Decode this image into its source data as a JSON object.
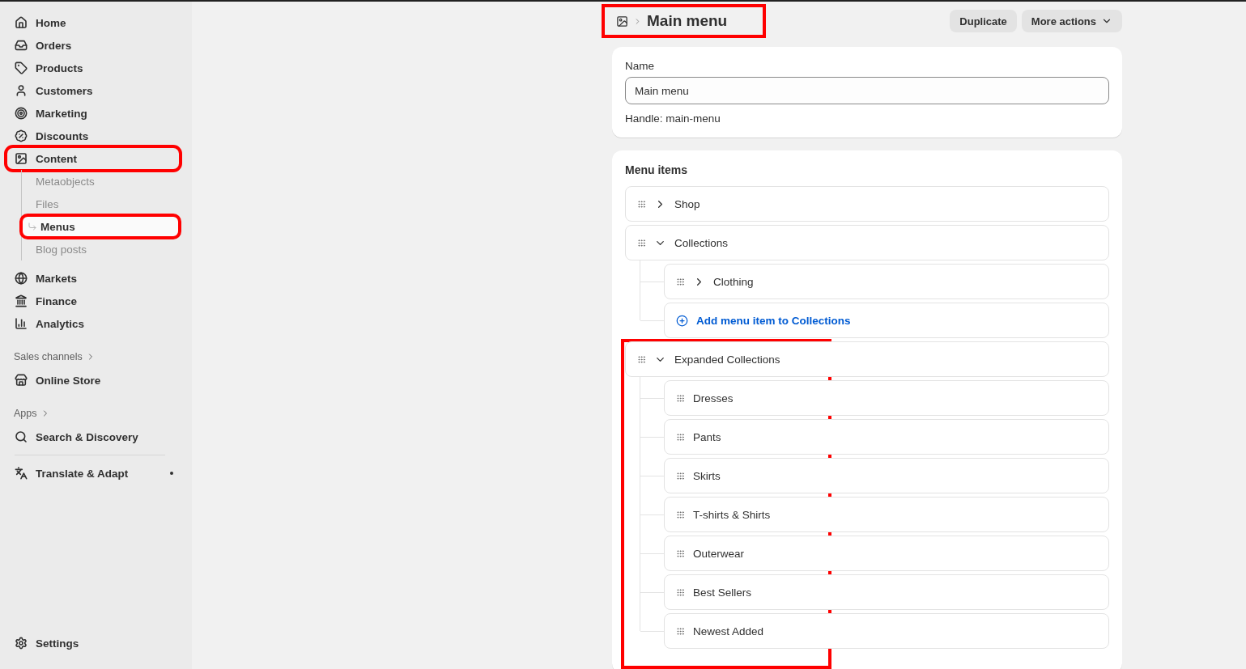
{
  "sidebar": {
    "items": [
      {
        "label": "Home",
        "selected": false,
        "annotated": false
      },
      {
        "label": "Orders",
        "selected": false,
        "annotated": false
      },
      {
        "label": "Products",
        "selected": false,
        "annotated": false
      },
      {
        "label": "Customers",
        "selected": false,
        "annotated": false
      },
      {
        "label": "Marketing",
        "selected": false,
        "annotated": false
      },
      {
        "label": "Discounts",
        "selected": false,
        "annotated": false
      },
      {
        "label": "Content",
        "selected": false,
        "annotated": true,
        "children": [
          {
            "label": "Metaobjects",
            "selected": false,
            "annotated": false
          },
          {
            "label": "Files",
            "selected": false,
            "annotated": false
          },
          {
            "label": "Menus",
            "selected": true,
            "annotated": true
          },
          {
            "label": "Blog posts",
            "selected": false,
            "annotated": false
          }
        ]
      },
      {
        "label": "Markets",
        "selected": false,
        "annotated": false
      },
      {
        "label": "Finance",
        "selected": false,
        "annotated": false
      },
      {
        "label": "Analytics",
        "selected": false,
        "annotated": false
      }
    ],
    "sections": [
      {
        "heading": "Sales channels",
        "items": [
          {
            "label": "Online Store",
            "dot": false
          }
        ]
      },
      {
        "heading": "Apps",
        "items": [
          {
            "label": "Search & Discovery",
            "dot": false
          },
          {
            "label": "Translate & Adapt",
            "dot": true
          }
        ]
      }
    ],
    "settings": "Settings"
  },
  "header": {
    "title": "Main menu",
    "annotated": true,
    "actions": [
      {
        "label": "Duplicate",
        "menu": false
      },
      {
        "label": "More actions",
        "menu": true
      }
    ]
  },
  "name_card": {
    "label": "Name",
    "value": "Main menu",
    "handle": "Handle: main-menu"
  },
  "menu_items": {
    "title": "Menu items",
    "items": [
      {
        "label": "Shop",
        "expanded": false,
        "annotated": false
      },
      {
        "label": "Collections",
        "expanded": true,
        "annotated": false,
        "children": [
          {
            "label": "Clothing",
            "expanded": false
          }
        ],
        "add_label": "Add menu item to Collections"
      },
      {
        "label": "Expanded Collections",
        "expanded": true,
        "annotated": true,
        "children": [
          {
            "label": "Dresses"
          },
          {
            "label": "Pants"
          },
          {
            "label": "Skirts"
          },
          {
            "label": "T-shirts & Shirts"
          },
          {
            "label": "Outerwear"
          },
          {
            "label": "Best Sellers"
          },
          {
            "label": "Newest Added"
          }
        ]
      }
    ]
  }
}
